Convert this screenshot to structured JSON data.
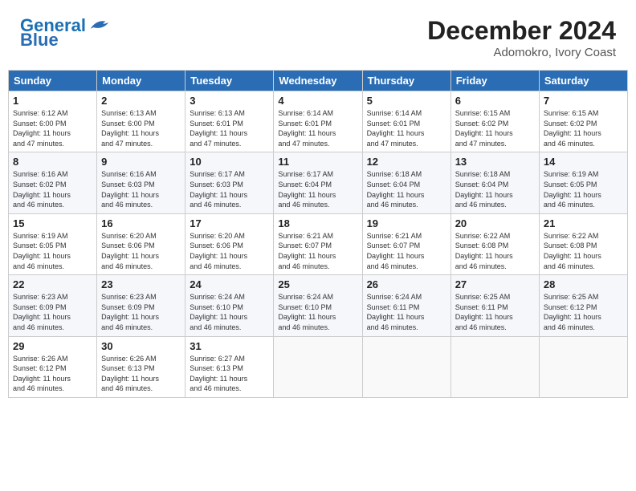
{
  "logo": {
    "line1": "General",
    "line2": "Blue"
  },
  "title": "December 2024",
  "subtitle": "Adomokro, Ivory Coast",
  "days_of_week": [
    "Sunday",
    "Monday",
    "Tuesday",
    "Wednesday",
    "Thursday",
    "Friday",
    "Saturday"
  ],
  "weeks": [
    [
      {
        "day": 1,
        "sunrise": "6:12 AM",
        "sunset": "6:00 PM",
        "daylight": "11 hours and 47 minutes."
      },
      {
        "day": 2,
        "sunrise": "6:13 AM",
        "sunset": "6:00 PM",
        "daylight": "11 hours and 47 minutes."
      },
      {
        "day": 3,
        "sunrise": "6:13 AM",
        "sunset": "6:01 PM",
        "daylight": "11 hours and 47 minutes."
      },
      {
        "day": 4,
        "sunrise": "6:14 AM",
        "sunset": "6:01 PM",
        "daylight": "11 hours and 47 minutes."
      },
      {
        "day": 5,
        "sunrise": "6:14 AM",
        "sunset": "6:01 PM",
        "daylight": "11 hours and 47 minutes."
      },
      {
        "day": 6,
        "sunrise": "6:15 AM",
        "sunset": "6:02 PM",
        "daylight": "11 hours and 47 minutes."
      },
      {
        "day": 7,
        "sunrise": "6:15 AM",
        "sunset": "6:02 PM",
        "daylight": "11 hours and 46 minutes."
      }
    ],
    [
      {
        "day": 8,
        "sunrise": "6:16 AM",
        "sunset": "6:02 PM",
        "daylight": "11 hours and 46 minutes."
      },
      {
        "day": 9,
        "sunrise": "6:16 AM",
        "sunset": "6:03 PM",
        "daylight": "11 hours and 46 minutes."
      },
      {
        "day": 10,
        "sunrise": "6:17 AM",
        "sunset": "6:03 PM",
        "daylight": "11 hours and 46 minutes."
      },
      {
        "day": 11,
        "sunrise": "6:17 AM",
        "sunset": "6:04 PM",
        "daylight": "11 hours and 46 minutes."
      },
      {
        "day": 12,
        "sunrise": "6:18 AM",
        "sunset": "6:04 PM",
        "daylight": "11 hours and 46 minutes."
      },
      {
        "day": 13,
        "sunrise": "6:18 AM",
        "sunset": "6:04 PM",
        "daylight": "11 hours and 46 minutes."
      },
      {
        "day": 14,
        "sunrise": "6:19 AM",
        "sunset": "6:05 PM",
        "daylight": "11 hours and 46 minutes."
      }
    ],
    [
      {
        "day": 15,
        "sunrise": "6:19 AM",
        "sunset": "6:05 PM",
        "daylight": "11 hours and 46 minutes."
      },
      {
        "day": 16,
        "sunrise": "6:20 AM",
        "sunset": "6:06 PM",
        "daylight": "11 hours and 46 minutes."
      },
      {
        "day": 17,
        "sunrise": "6:20 AM",
        "sunset": "6:06 PM",
        "daylight": "11 hours and 46 minutes."
      },
      {
        "day": 18,
        "sunrise": "6:21 AM",
        "sunset": "6:07 PM",
        "daylight": "11 hours and 46 minutes."
      },
      {
        "day": 19,
        "sunrise": "6:21 AM",
        "sunset": "6:07 PM",
        "daylight": "11 hours and 46 minutes."
      },
      {
        "day": 20,
        "sunrise": "6:22 AM",
        "sunset": "6:08 PM",
        "daylight": "11 hours and 46 minutes."
      },
      {
        "day": 21,
        "sunrise": "6:22 AM",
        "sunset": "6:08 PM",
        "daylight": "11 hours and 46 minutes."
      }
    ],
    [
      {
        "day": 22,
        "sunrise": "6:23 AM",
        "sunset": "6:09 PM",
        "daylight": "11 hours and 46 minutes."
      },
      {
        "day": 23,
        "sunrise": "6:23 AM",
        "sunset": "6:09 PM",
        "daylight": "11 hours and 46 minutes."
      },
      {
        "day": 24,
        "sunrise": "6:24 AM",
        "sunset": "6:10 PM",
        "daylight": "11 hours and 46 minutes."
      },
      {
        "day": 25,
        "sunrise": "6:24 AM",
        "sunset": "6:10 PM",
        "daylight": "11 hours and 46 minutes."
      },
      {
        "day": 26,
        "sunrise": "6:24 AM",
        "sunset": "6:11 PM",
        "daylight": "11 hours and 46 minutes."
      },
      {
        "day": 27,
        "sunrise": "6:25 AM",
        "sunset": "6:11 PM",
        "daylight": "11 hours and 46 minutes."
      },
      {
        "day": 28,
        "sunrise": "6:25 AM",
        "sunset": "6:12 PM",
        "daylight": "11 hours and 46 minutes."
      }
    ],
    [
      {
        "day": 29,
        "sunrise": "6:26 AM",
        "sunset": "6:12 PM",
        "daylight": "11 hours and 46 minutes."
      },
      {
        "day": 30,
        "sunrise": "6:26 AM",
        "sunset": "6:13 PM",
        "daylight": "11 hours and 46 minutes."
      },
      {
        "day": 31,
        "sunrise": "6:27 AM",
        "sunset": "6:13 PM",
        "daylight": "11 hours and 46 minutes."
      },
      null,
      null,
      null,
      null
    ]
  ]
}
